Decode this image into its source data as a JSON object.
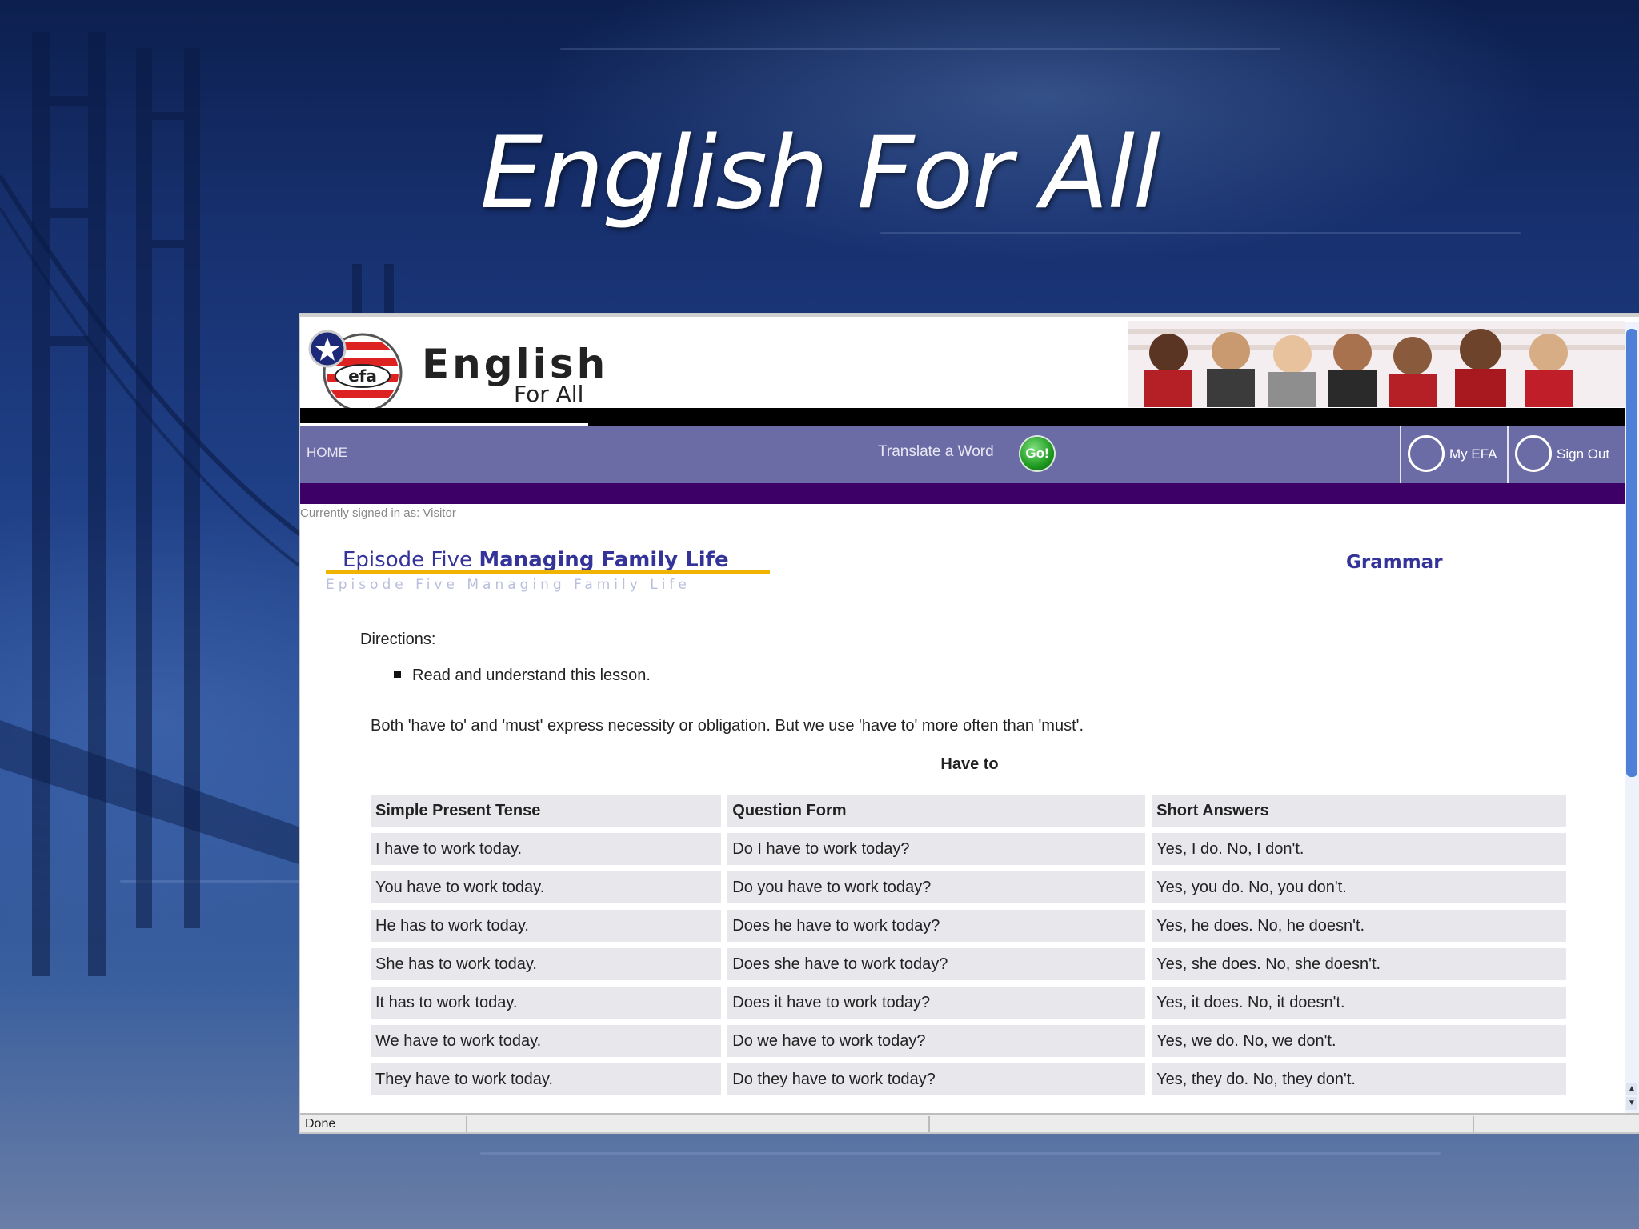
{
  "slide": {
    "title": "English For All"
  },
  "app": {
    "logo_badge": "efa",
    "logo_text1": "English",
    "logo_text2": "For All",
    "nav": {
      "home": "HOME",
      "translate": "Translate a Word",
      "go": "Go!",
      "myefa": "My EFA",
      "signout": "Sign Out"
    },
    "signed_in": "Currently signed in as: Visitor",
    "episode": {
      "prefix": "Episode Five",
      "name": "Managing Family Life",
      "reflection": "Episode Five Managing Family Life"
    },
    "section": "Grammar",
    "directions_label": "Directions:",
    "directions": [
      "Read and understand this lesson."
    ],
    "explanation": "Both 'have to' and 'must' express necessity or obligation. But we use 'have to' more often than 'must'.",
    "table_title": "Have to",
    "table": {
      "headers": [
        "Simple Present Tense",
        "Question Form",
        "Short Answers"
      ],
      "rows": [
        [
          "I have to work today.",
          "Do I have to work today?",
          "Yes, I do. No, I don't."
        ],
        [
          "You have to work today.",
          "Do you have to work today?",
          "Yes, you do. No, you don't."
        ],
        [
          "He has to work today.",
          "Does he have to work today?",
          "Yes, he does. No, he doesn't."
        ],
        [
          "She has to work today.",
          "Does she have to work today?",
          "Yes, she does. No, she doesn't."
        ],
        [
          "It has to work today.",
          "Does it have to work today?",
          "Yes, it does. No, it doesn't."
        ],
        [
          "We have to work today.",
          "Do we have to work today?",
          "Yes, we do. No, we don't."
        ],
        [
          "They have to work today.",
          "Do they have to work today?",
          "Yes, they do. No, they don't."
        ]
      ]
    },
    "status": "Done"
  },
  "colors": {
    "nav_bar": "#6b6ba6",
    "nav_bar_dark": "#3d0066",
    "title_blue": "#333399",
    "underline_gold": "#f0b400",
    "cell_bg": "#e7e7ec"
  }
}
